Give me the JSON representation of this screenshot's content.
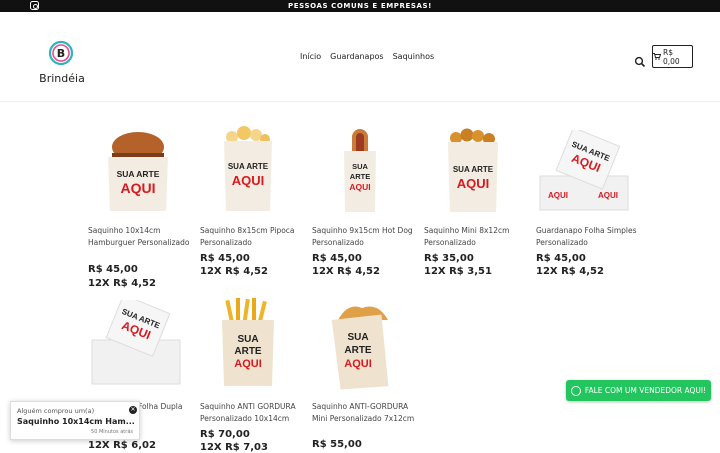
{
  "topbar": {
    "message": "PESSOAS COMUNS E EMPRESAS!"
  },
  "header": {
    "logo_text": "Brindéia",
    "nav": [
      "Início",
      "Guardanapos",
      "Saquinhos"
    ],
    "cart_label": "R$ 0,00"
  },
  "products": [
    {
      "title": "Saquinho 10x14cm Hamburguer Personalizado",
      "price": "R$ 45,00",
      "installment": "12X R$ 4,52",
      "image": "burger-bag",
      "art": [
        "SUA ARTE",
        "AQUI"
      ]
    },
    {
      "title": "Saquinho 8x15cm Pipoca Personalizado",
      "price": "R$ 45,00",
      "installment": "12X R$ 4,52",
      "image": "popcorn-bag",
      "art": [
        "SUA ARTE",
        "AQUI"
      ]
    },
    {
      "title": "Saquinho 9x15cm Hot Dog Personalizado",
      "price": "R$ 45,00",
      "installment": "12X R$ 4,52",
      "image": "hotdog-bag",
      "art": [
        "SUA",
        "ARTE",
        "AQUI"
      ]
    },
    {
      "title": "Saquinho Mini 8x12cm Personalizado",
      "price": "R$ 35,00",
      "installment": "12X R$ 3,51",
      "image": "mini-bag",
      "art": [
        "SUA ARTE",
        "AQUI"
      ]
    },
    {
      "title": "Guardanapo Folha Simples Personalizado",
      "price": "R$ 45,00",
      "installment": "12X R$ 4,52",
      "image": "napkins",
      "art": [
        "SUA ARTE",
        "AQUI"
      ]
    },
    {
      "title": "Folha Dupla",
      "price": "",
      "installment": "12X R$ 6,02",
      "image": "napkins-double",
      "art": [
        "SUA ARTE",
        "AQUI"
      ]
    },
    {
      "title": "Saquinho ANTI GORDURA Personalizado 10x14cm",
      "price": "R$ 70,00",
      "installment": "12X R$ 7,03",
      "image": "fries-bag",
      "art": [
        "SUA",
        "ARTE",
        "AQUI"
      ]
    },
    {
      "title": "Saquinho ANTI-GORDURA Mini Personalizado 7x12cm",
      "price": "R$ 55,00",
      "installment": "",
      "image": "pastel-bag",
      "art": [
        "SUA",
        "ARTE",
        "AQUI"
      ]
    }
  ],
  "whatsapp": {
    "label": "FALE COM UM VENDEDOR AQUI!"
  },
  "popup": {
    "line1": "Alguém comprou um(a)",
    "product": "Saquinho 10x14cm Ham...",
    "time": "50 Minutos atrás"
  },
  "colors": {
    "accent_red": "#d71920",
    "whatsapp_green": "#22c55e",
    "topbar": "#111111"
  }
}
